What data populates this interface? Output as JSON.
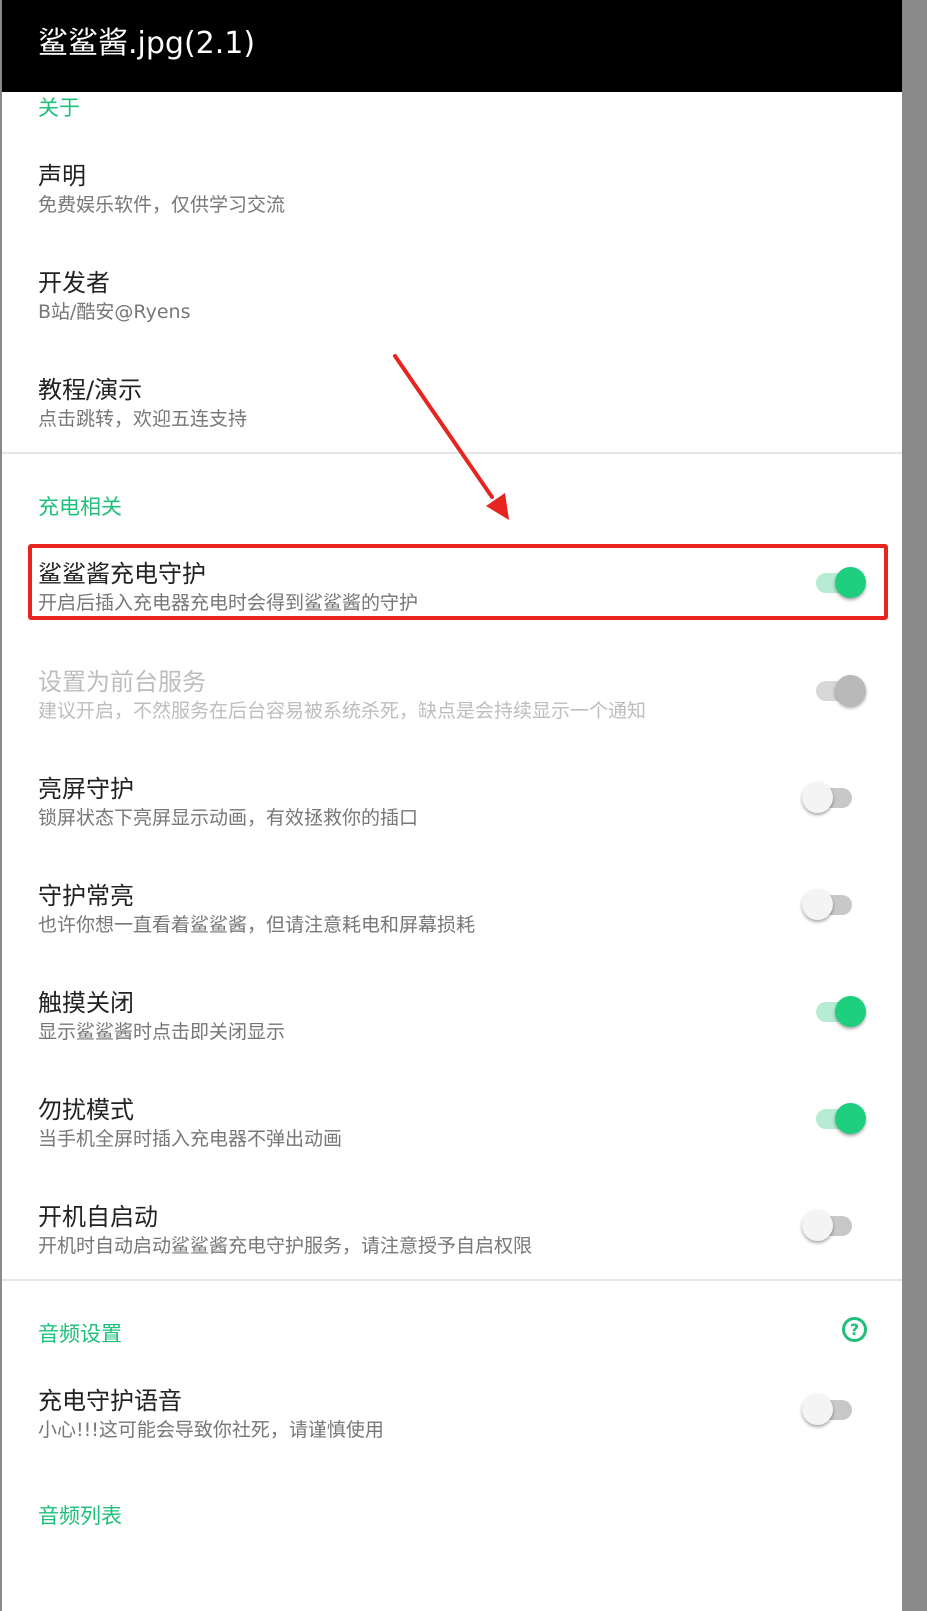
{
  "titlebar": {
    "title": "鲨鲨酱.jpg(2.1)"
  },
  "sections": {
    "about": {
      "title": "关于"
    },
    "charging": {
      "title": "充电相关"
    },
    "audio": {
      "title": "音频设置"
    },
    "audio_list": {
      "title": "音频列表"
    }
  },
  "about_items": [
    {
      "title": "声明",
      "subtitle": "免费娱乐软件，仅供学习交流"
    },
    {
      "title": "开发者",
      "subtitle": "B站/酷安@Ryens"
    },
    {
      "title": "教程/演示",
      "subtitle": "点击跳转，欢迎五连支持"
    }
  ],
  "charging_items": [
    {
      "title": "鲨鲨酱充电守护",
      "subtitle": "开启后插入充电器充电时会得到鲨鲨酱的守护",
      "toggle": "on"
    },
    {
      "title": "设置为前台服务",
      "subtitle": "建议开启，不然服务在后台容易被系统杀死，缺点是会持续显示一个通知",
      "toggle": "disabled-on"
    },
    {
      "title": "亮屏守护",
      "subtitle": "锁屏状态下亮屏显示动画，有效拯救你的插口",
      "toggle": "off"
    },
    {
      "title": "守护常亮",
      "subtitle": "也许你想一直看着鲨鲨酱，但请注意耗电和屏幕损耗",
      "toggle": "off"
    },
    {
      "title": "触摸关闭",
      "subtitle": "显示鲨鲨酱时点击即关闭显示",
      "toggle": "on"
    },
    {
      "title": "勿扰模式",
      "subtitle": "当手机全屏时插入充电器不弹出动画",
      "toggle": "on"
    },
    {
      "title": "开机自启动",
      "subtitle": "开机时自动启动鲨鲨酱充电守护服务，请注意授予自启权限",
      "toggle": "off"
    }
  ],
  "audio_items": [
    {
      "title": "充电守护语音",
      "subtitle": "小心!!!这可能会导致你社死，请谨慎使用",
      "toggle": "off"
    }
  ],
  "icons": {
    "help": "help-circle-icon",
    "help_glyph": "?"
  },
  "colors": {
    "accent": "#1fc07a",
    "highlight": "#e8241f",
    "titlebar": "#000000"
  }
}
